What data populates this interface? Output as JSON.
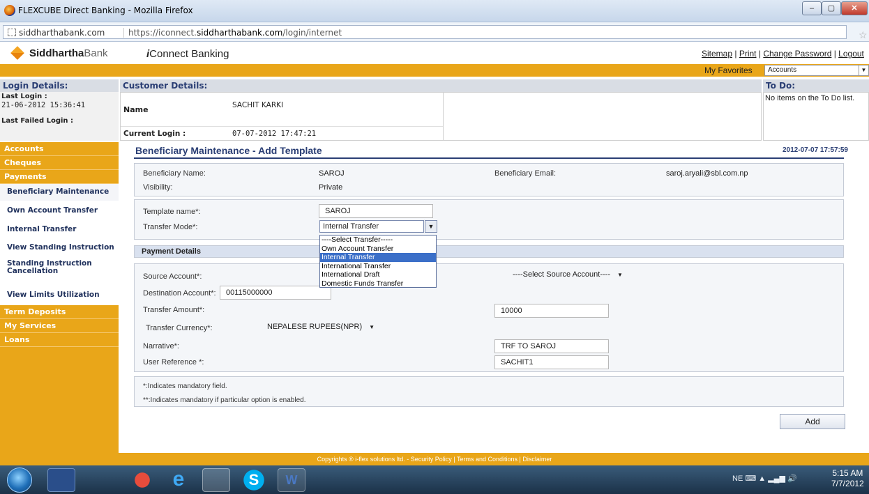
{
  "browser": {
    "window_title": "FLEXCUBE Direct Banking - Mozilla Firefox",
    "url_domain": "siddharthabank.com",
    "url_prefix": "https://iconnect.",
    "url_host": "siddharthabank.com",
    "url_path": "/login/internet"
  },
  "header": {
    "logo_bold": "Siddhartha",
    "logo_thin": "Bank",
    "product_prefix": "i",
    "product_name": "Connect Banking",
    "links": [
      "Sitemap",
      "Print",
      "Change Password",
      "Logout"
    ],
    "favorites_label": "My Favorites",
    "favorites_value": "Accounts"
  },
  "login_details": {
    "title": "Login Details:",
    "last_login_label": "Last Login :",
    "last_login_value": "21-06-2012 15:36:41",
    "last_failed_label": "Last Failed Login :"
  },
  "customer_details": {
    "title": "Customer Details:",
    "name_label": "Name",
    "name_value": "SACHIT KARKI",
    "current_login_label": "Current Login :",
    "current_login_value": "07-07-2012 17:47:21"
  },
  "todo": {
    "title": "To Do:",
    "message": "No items on the To Do list."
  },
  "sidebar": {
    "accounts": "Accounts",
    "cheques": "Cheques",
    "payments": "Payments",
    "payment_items": [
      "Beneficiary Maintenance",
      "Own Account Transfer",
      "Internal Transfer",
      "View Standing Instruction",
      "Standing Instruction Cancellation",
      "View Limits Utilization"
    ],
    "term_deposits": "Term Deposits",
    "my_services": "My Services",
    "loans": "Loans"
  },
  "content": {
    "title": "Beneficiary Maintenance - Add Template",
    "datetime": "2012-07-07 17:57:59",
    "beneficiary_name_label": "Beneficiary Name:",
    "beneficiary_name_value": "SAROJ",
    "beneficiary_email_label": "Beneficiary Email:",
    "beneficiary_email_value": "saroj.aryali@sbl.com.np",
    "visibility_label": "Visibility:",
    "visibility_value": "Private",
    "template_name_label": "Template name*:",
    "template_name_value": "SAROJ",
    "transfer_mode_label": "Transfer Mode*:",
    "transfer_mode_value": "Internal Transfer",
    "transfer_mode_options": [
      "----Select Transfer-----",
      "Own Account Transfer",
      "Internal Transfer",
      "International Transfer",
      "International Draft",
      "Domestic Funds Transfer"
    ],
    "payment_details_label": "Payment Details",
    "source_account_label": "Source Account*:",
    "source_account_value": "----Select Source Account----",
    "destination_account_label": "Destination Account*:",
    "destination_account_value": "00115000000",
    "transfer_amount_label": "Transfer Amount*:",
    "transfer_amount_value": "10000",
    "transfer_currency_label": "Transfer Currency*:",
    "transfer_currency_value": "NEPALESE RUPEES(NPR)",
    "narrative_label": "Narrative*:",
    "narrative_value": "TRF TO SAROJ",
    "user_reference_label": "User Reference *:",
    "user_reference_value": "SACHIT1",
    "note1": "*:Indicates mandatory field.",
    "note2": "**:Indicates mandatory if particular option is enabled.",
    "add_button": "Add"
  },
  "footer": {
    "text": "Copyrights ® i-flex solutions ltd. - Security Policy | Terms and Conditions | Disclaimer"
  },
  "taskbar": {
    "lang": "NE",
    "time": "5:15 AM",
    "date": "7/7/2012"
  },
  "colors": {
    "accent_orange": "#e9a619",
    "heading_blue": "#2a3e74",
    "selected_option": "#3b6fc8"
  }
}
